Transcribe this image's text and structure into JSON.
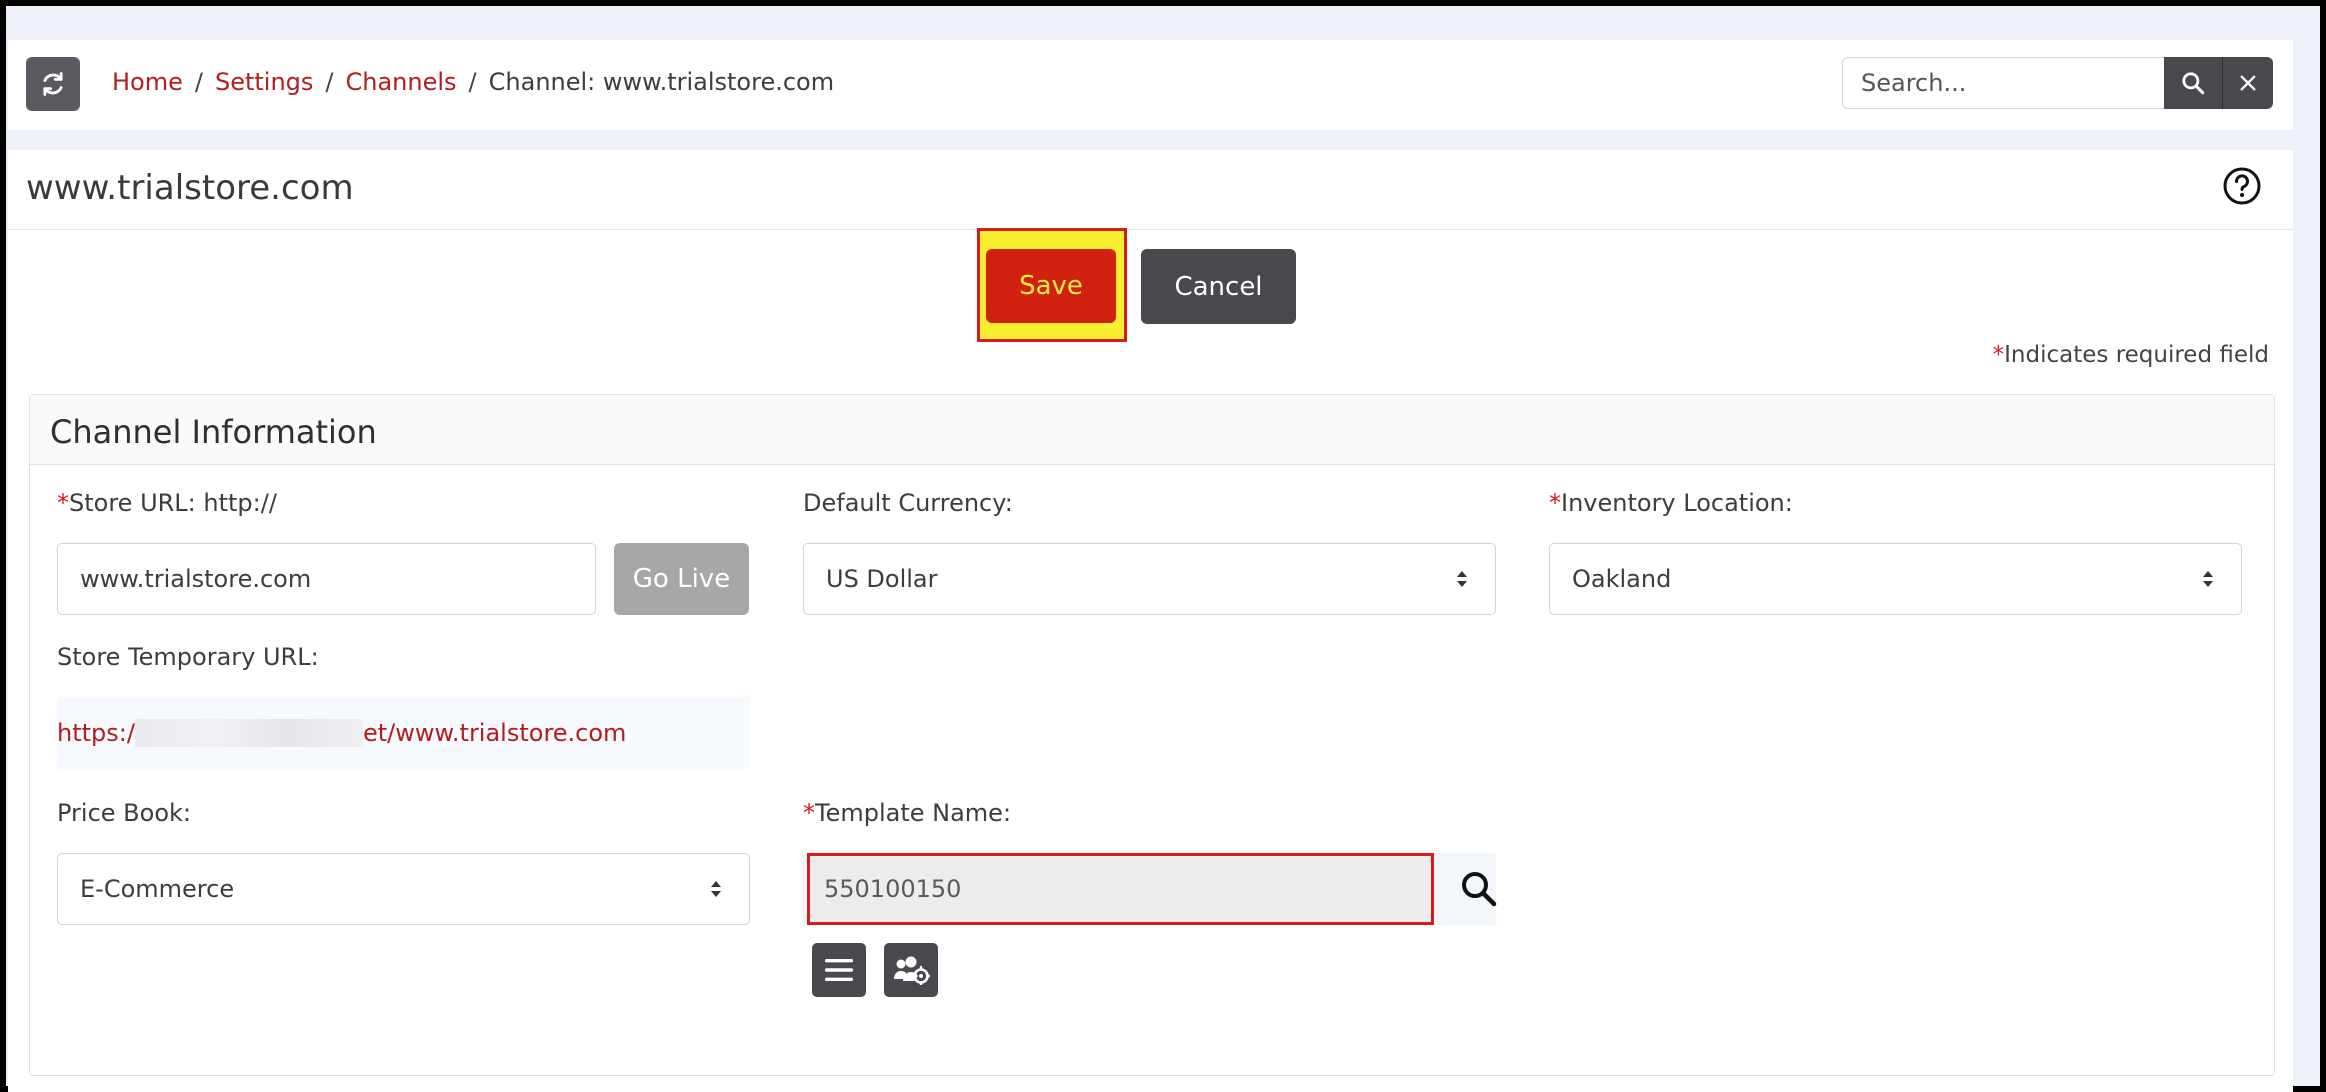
{
  "header": {
    "breadcrumb": [
      {
        "label": "Home"
      },
      {
        "label": "Settings"
      },
      {
        "label": "Channels"
      }
    ],
    "breadcrumb_current": "Channel: www.trialstore.com",
    "search_placeholder": "Search...",
    "icons": {
      "refresh": "refresh-icon",
      "search": "search-icon",
      "clear": "close-icon"
    }
  },
  "page": {
    "title": "www.trialstore.com",
    "save_label": "Save",
    "cancel_label": "Cancel",
    "required_star": "*",
    "required_note": "Indicates required field"
  },
  "card": {
    "title": "Channel Information",
    "store_url": {
      "label": "Store URL: http://",
      "value": "www.trialstore.com",
      "go_live_label": "Go Live"
    },
    "default_currency": {
      "label": "Default Currency:",
      "value": "US Dollar"
    },
    "inventory_location": {
      "label": "Inventory Location:",
      "value": "Oakland"
    },
    "temp_url": {
      "label": "Store Temporary URL:",
      "prefix": "https:/",
      "suffix": "et/www.trialstore.com"
    },
    "price_book": {
      "label": "Price Book:",
      "value": "E-Commerce"
    },
    "template_name": {
      "label": "Template Name:",
      "value": "550100150"
    }
  },
  "colors": {
    "accent": "#b31d1d",
    "save_bg": "#d0220f",
    "highlight": "#f7ef2f",
    "dark_button": "#48494d"
  }
}
